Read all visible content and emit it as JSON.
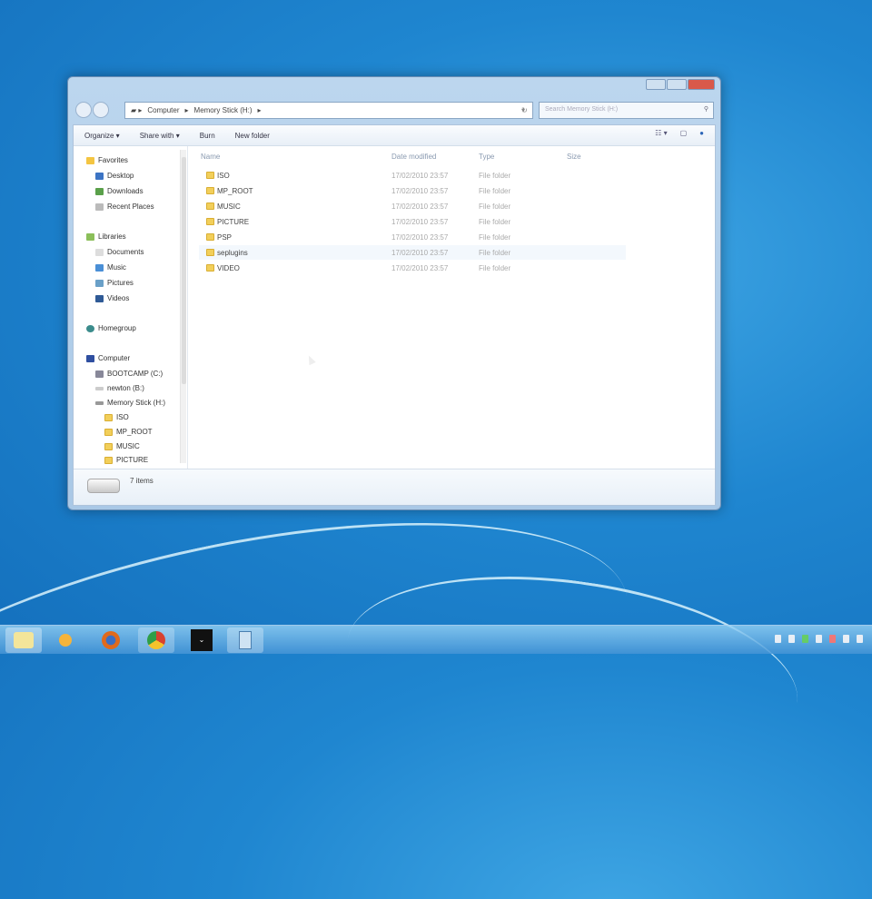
{
  "window": {
    "breadcrumb": [
      "Computer",
      "Memory Stick (H:)"
    ],
    "search_placeholder": "Search Memory Stick (H:)",
    "toolbar": {
      "organize": "Organize ▾",
      "share_with": "Share with ▾",
      "burn": "Burn",
      "new_folder": "New folder"
    },
    "nav": {
      "favorites": "Favorites",
      "desktop": "Desktop",
      "downloads": "Downloads",
      "recent": "Recent Places",
      "libraries": "Libraries",
      "documents": "Documents",
      "music": "Music",
      "pictures": "Pictures",
      "videos": "Videos",
      "homegroup": "Homegroup",
      "computer": "Computer",
      "bootcamp": "BOOTCAMP (C:)",
      "newton": "newton (B:)",
      "memstick": "Memory Stick (H:)",
      "sub": [
        "ISO",
        "MP_ROOT",
        "MUSIC",
        "PICTURE"
      ]
    },
    "columns": {
      "name": "Name",
      "date": "Date modified",
      "type": "Type",
      "size": "Size"
    },
    "files": [
      {
        "name": "ISO",
        "date": "17/02/2010 23:57",
        "type": "File folder"
      },
      {
        "name": "MP_ROOT",
        "date": "17/02/2010 23:57",
        "type": "File folder"
      },
      {
        "name": "MUSIC",
        "date": "17/02/2010 23:57",
        "type": "File folder"
      },
      {
        "name": "PICTURE",
        "date": "17/02/2010 23:57",
        "type": "File folder"
      },
      {
        "name": "PSP",
        "date": "17/02/2010 23:57",
        "type": "File folder"
      },
      {
        "name": "seplugins",
        "date": "17/02/2010 23:57",
        "type": "File folder"
      },
      {
        "name": "VIDEO",
        "date": "17/02/2010 23:57",
        "type": "File folder"
      }
    ],
    "status": "7 items"
  }
}
